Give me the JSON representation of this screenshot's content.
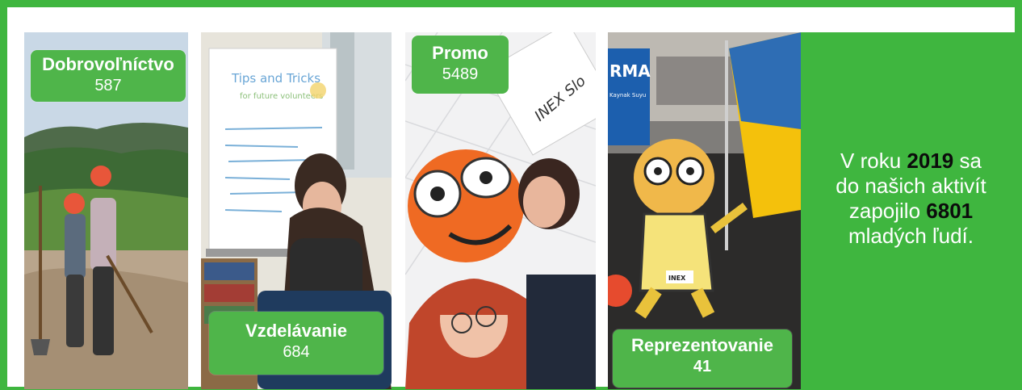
{
  "tiles": [
    {
      "label": "Dobrovoľníctvo",
      "count": "587"
    },
    {
      "label": "Vzdelávanie",
      "count": "684"
    },
    {
      "label": "Promo",
      "count": "5489"
    },
    {
      "label": "Reprezentovanie",
      "count": "41"
    }
  ],
  "summary": {
    "prefix": "V roku ",
    "year": "2019",
    "middle": " sa do našich aktivít zapojilo ",
    "total": "6801",
    "suffix": " mladých ľudí."
  },
  "photo_text": {
    "flipchart_title": "Tips and Tricks",
    "flipchart_subtitle": "for future volunteers",
    "inex_sign": "INEX Slo",
    "mascot_badge": "INEX",
    "bottle_label": "RMA",
    "bottle_sublabel": "Kaynak Suyu"
  },
  "colors": {
    "brand_green": "#3fb63f",
    "badge_green": "#4fb54a",
    "highlight_text": "#0c0c0c"
  }
}
